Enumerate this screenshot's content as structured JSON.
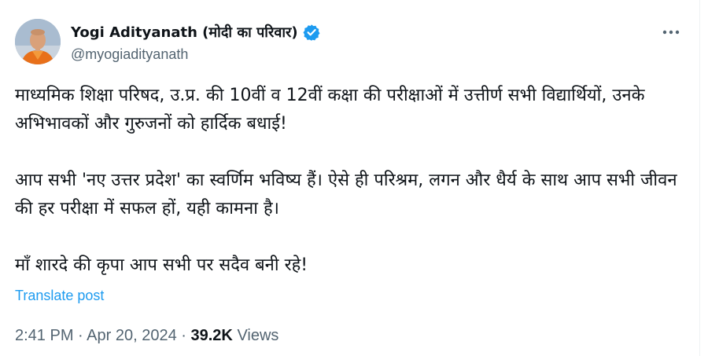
{
  "author": {
    "display_name": "Yogi Adityanath (मोदी का परिवार)",
    "handle": "@myogiadityanath",
    "verified_icon": "verified-badge-icon",
    "avatar_icon": "avatar"
  },
  "post": {
    "paragraph1": "माध्यमिक शिक्षा परिषद, उ.प्र. की 10वीं व 12वीं कक्षा की परीक्षाओं में उत्तीर्ण सभी विद्यार्थियों, उनके अभिभावकों और गुरुजनों को हार्दिक बधाई!",
    "paragraph2": "आप सभी 'नए उत्तर प्रदेश' का स्वर्णिम भविष्य हैं। ऐसे ही परिश्रम, लगन और धैर्य के साथ आप सभी जीवन की हर परीक्षा में सफल हों, यही कामना है।",
    "paragraph3": "माँ शारदे की कृपा आप सभी पर सदैव बनी रहे!",
    "translate_label": "Translate post"
  },
  "meta": {
    "time": "2:41 PM",
    "separator": "·",
    "date": "Apr 20, 2024",
    "views_count": "39.2K",
    "views_label": "Views"
  },
  "colors": {
    "text_primary": "#0f1419",
    "text_secondary": "#536471",
    "link": "#1d9bf0",
    "verified": "#1d9bf0"
  },
  "more_icon": "more-horizontal-icon"
}
